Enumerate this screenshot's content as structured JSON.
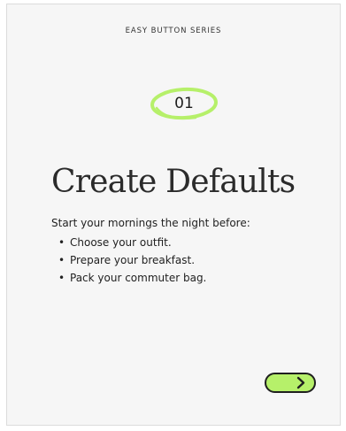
{
  "card": {
    "series_label": "EASY BUTTON SERIES",
    "step_number": "01",
    "title": "Create Defaults",
    "intro": "Start your mornings the night before:",
    "tips": [
      "Choose your outfit.",
      "Prepare your breakfast.",
      "Pack your commuter bag."
    ],
    "next_icon": "chevron-right-icon"
  },
  "colors": {
    "accent": "#b6f06a",
    "card_background": "#f6f6f6",
    "text": "#222222"
  }
}
